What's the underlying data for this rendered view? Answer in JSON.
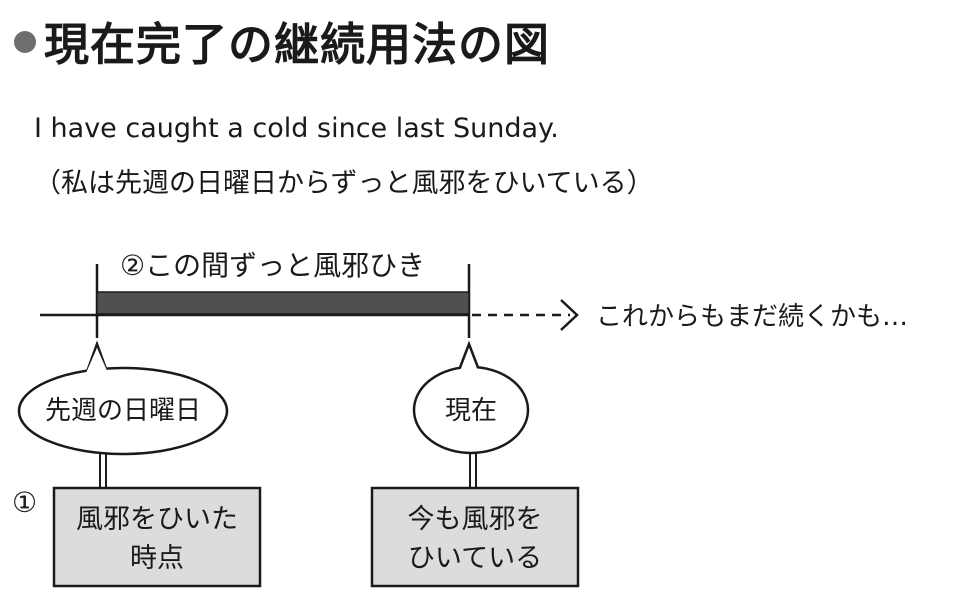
{
  "title": "現在完了の継続用法の図",
  "example": {
    "sentence": "I have caught a cold since last Sunday.",
    "translation": "（私は先週の日曜日からずっと風邪をひいている）"
  },
  "timeline": {
    "duration_label": "②この間ずっと風邪ひき",
    "continuation_label": "これからもまだ続くかも…",
    "start_bubble": "先週の日曜日",
    "now_bubble": "現在",
    "marker": "①",
    "start_box_lines": [
      "風邪をひいた",
      "時点"
    ],
    "now_box_lines": [
      "今も風邪を",
      "ひいている"
    ]
  },
  "colors": {
    "bar_fill": "#505050",
    "box_fill": "#dcdcdc",
    "bullet": "#6e6e6e"
  }
}
